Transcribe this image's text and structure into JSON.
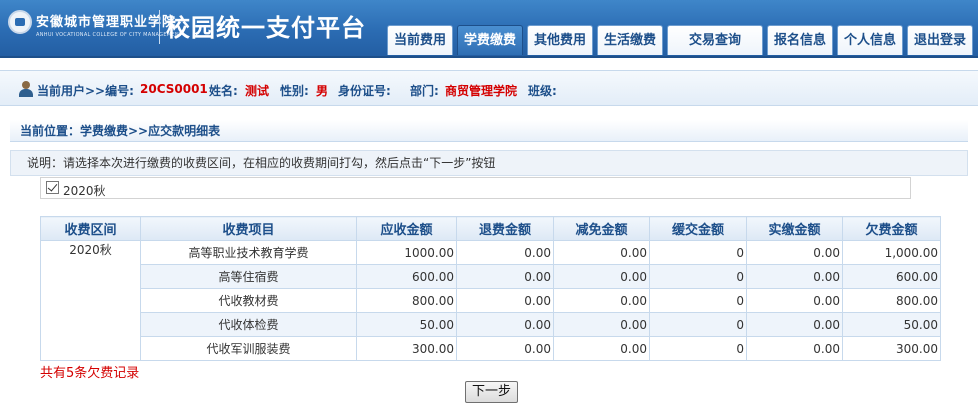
{
  "header": {
    "school_name": "安徽城市管理职业学院",
    "school_name_en": "ANHUI VOCATIONAL COLLEGE OF CITY MANAGEMENT",
    "site_title": "校园统一支付平台",
    "nav": [
      {
        "label": "当前费用",
        "active": false
      },
      {
        "label": "学费缴费",
        "active": true
      },
      {
        "label": "其他费用",
        "active": false
      },
      {
        "label": "生活缴费",
        "active": false
      },
      {
        "label": "交易查询",
        "active": false
      },
      {
        "label": "报名信息",
        "active": false
      },
      {
        "label": "个人信息",
        "active": false
      },
      {
        "label": "退出登录",
        "active": false
      }
    ]
  },
  "user": {
    "prefix": "当前用户>>编号:",
    "id": "20CS0001",
    "name_label": "姓名:",
    "name": "测试",
    "gender_label": "性别:",
    "gender": "男",
    "idcard_label": "身份证号:",
    "dept_label": "部门:",
    "dept": "商贸管理学院",
    "class_label": "班级:"
  },
  "location": "当前位置：学费缴费>>应交款明细表",
  "note": "说明：请选择本次进行缴费的收费区间，在相应的收费期间打勾，然后点击“下一步”按钮",
  "period_checkbox": {
    "checked": true,
    "label": "2020秋"
  },
  "table": {
    "headers": [
      "收费区间",
      "收费项目",
      "应收金额",
      "退费金额",
      "减免金额",
      "缓交金额",
      "实缴金额",
      "欠费金额"
    ],
    "period": "2020秋",
    "rows": [
      {
        "item": "高等职业技术教育学费",
        "due": "1000.00",
        "refund": "0.00",
        "waive": "0.00",
        "defer": "0",
        "paid": "0.00",
        "owe": "1,000.00"
      },
      {
        "item": "高等住宿费",
        "due": "600.00",
        "refund": "0.00",
        "waive": "0.00",
        "defer": "0",
        "paid": "0.00",
        "owe": "600.00"
      },
      {
        "item": "代收教材费",
        "due": "800.00",
        "refund": "0.00",
        "waive": "0.00",
        "defer": "0",
        "paid": "0.00",
        "owe": "800.00"
      },
      {
        "item": "代收体检费",
        "due": "50.00",
        "refund": "0.00",
        "waive": "0.00",
        "defer": "0",
        "paid": "0.00",
        "owe": "50.00"
      },
      {
        "item": "代收军训服装费",
        "due": "300.00",
        "refund": "0.00",
        "waive": "0.00",
        "defer": "0",
        "paid": "0.00",
        "owe": "300.00"
      }
    ]
  },
  "summary": "共有5条欠费记录",
  "next_button": "下一步",
  "colors": {
    "header_blue": "#2b6cb3",
    "accent_red": "#d40000",
    "label_blue": "#1d4f8a"
  }
}
